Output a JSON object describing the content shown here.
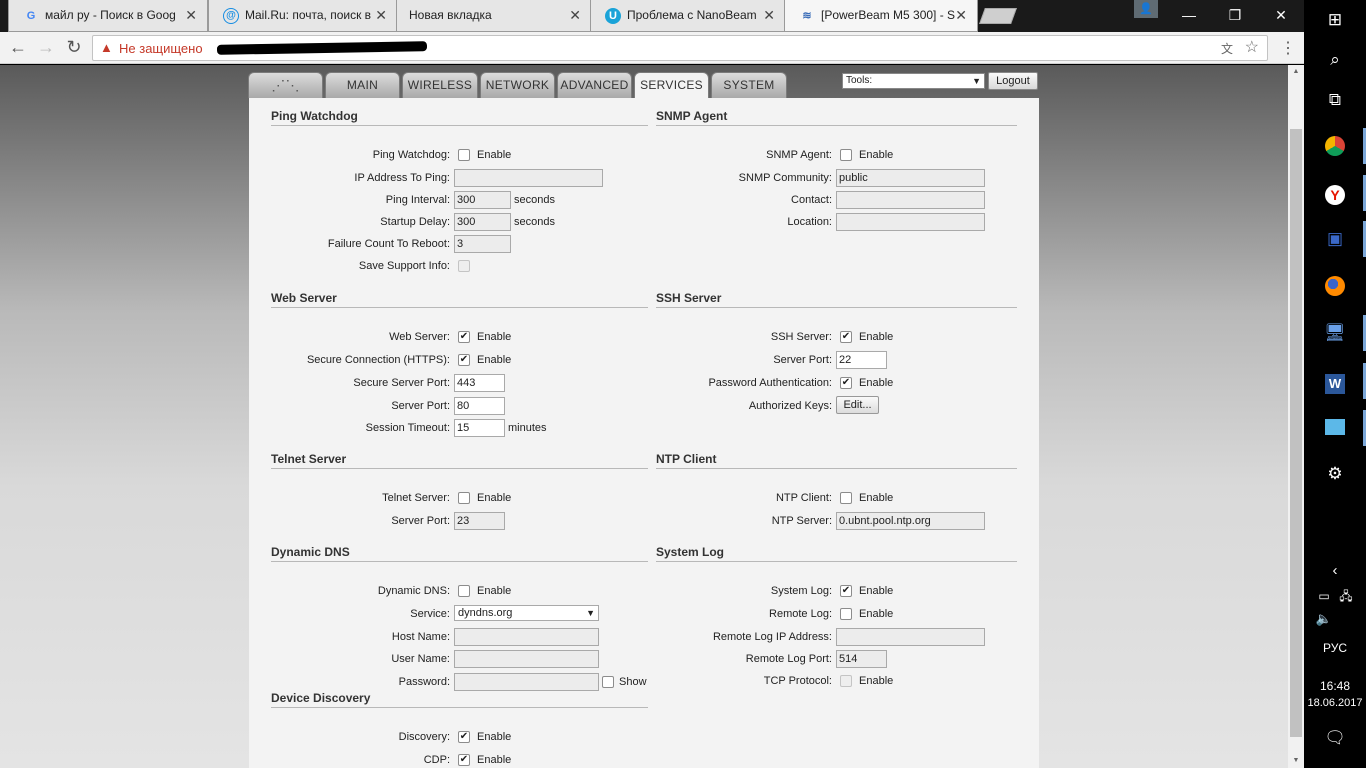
{
  "browser": {
    "tabs": [
      {
        "title": "майл ру - Поиск в Goog",
        "favicon": "G"
      },
      {
        "title": "Mail.Ru: почта, поиск в",
        "favicon": "@"
      },
      {
        "title": "Новая вкладка",
        "favicon": ""
      },
      {
        "title": "Проблема с NanoBeam",
        "favicon": "U"
      },
      {
        "title": "[PowerBeam M5 300] - S",
        "favicon": "rss"
      }
    ],
    "address": {
      "security_label": "Не защищено",
      "url_redacted": true
    }
  },
  "router": {
    "nav_tabs": [
      "MAIN",
      "WIRELESS",
      "NETWORK",
      "ADVANCED",
      "SERVICES",
      "SYSTEM"
    ],
    "active_tab": "SERVICES",
    "tools_label": "Tools:",
    "logout_label": "Logout",
    "ping_watchdog": {
      "title": "Ping Watchdog",
      "enable_label": "Ping Watchdog:",
      "enable_text": "Enable",
      "ip_label": "IP Address To Ping:",
      "ip_value": "",
      "interval_label": "Ping Interval:",
      "interval_value": "300",
      "interval_unit": "seconds",
      "startup_label": "Startup Delay:",
      "startup_value": "300",
      "startup_unit": "seconds",
      "failure_label": "Failure Count To Reboot:",
      "failure_value": "3",
      "support_label": "Save Support Info:"
    },
    "snmp": {
      "title": "SNMP Agent",
      "agent_label": "SNMP Agent:",
      "enable_text": "Enable",
      "community_label": "SNMP Community:",
      "community_value": "public",
      "contact_label": "Contact:",
      "contact_value": "",
      "location_label": "Location:",
      "location_value": ""
    },
    "web_server": {
      "title": "Web Server",
      "server_label": "Web Server:",
      "enable_text": "Enable",
      "https_label": "Secure Connection (HTTPS):",
      "https_enable_text": "Enable",
      "secure_port_label": "Secure Server Port:",
      "secure_port_value": "443",
      "port_label": "Server Port:",
      "port_value": "80",
      "timeout_label": "Session Timeout:",
      "timeout_value": "15",
      "timeout_unit": "minutes"
    },
    "ssh": {
      "title": "SSH Server",
      "server_label": "SSH Server:",
      "enable_text": "Enable",
      "port_label": "Server Port:",
      "port_value": "22",
      "password_label": "Password Authentication:",
      "password_enable_text": "Enable",
      "keys_label": "Authorized Keys:",
      "keys_button": "Edit..."
    },
    "telnet": {
      "title": "Telnet Server",
      "server_label": "Telnet Server:",
      "enable_text": "Enable",
      "port_label": "Server Port:",
      "port_value": "23"
    },
    "ntp": {
      "title": "NTP Client",
      "client_label": "NTP Client:",
      "enable_text": "Enable",
      "server_label": "NTP Server:",
      "server_value": "0.ubnt.pool.ntp.org"
    },
    "ddns": {
      "title": "Dynamic DNS",
      "ddns_label": "Dynamic DNS:",
      "enable_text": "Enable",
      "service_label": "Service:",
      "service_value": "dyndns.org",
      "host_label": "Host Name:",
      "host_value": "",
      "user_label": "User Name:",
      "user_value": "",
      "password_label": "Password:",
      "password_value": "",
      "show_label": "Show"
    },
    "syslog": {
      "title": "System Log",
      "log_label": "System Log:",
      "enable_text": "Enable",
      "remote_label": "Remote Log:",
      "remote_enable_text": "Enable",
      "remote_ip_label": "Remote Log IP Address:",
      "remote_ip_value": "",
      "remote_port_label": "Remote Log Port:",
      "remote_port_value": "514",
      "tcp_label": "TCP Protocol:",
      "tcp_enable_text": "Enable"
    },
    "discovery": {
      "title": "Device Discovery",
      "discovery_label": "Discovery:",
      "enable_text": "Enable",
      "cdp_label": "CDP:",
      "cdp_enable_text": "Enable"
    }
  },
  "taskbar": {
    "language": "РУС",
    "time": "16:48",
    "date": "18.06.2017"
  }
}
